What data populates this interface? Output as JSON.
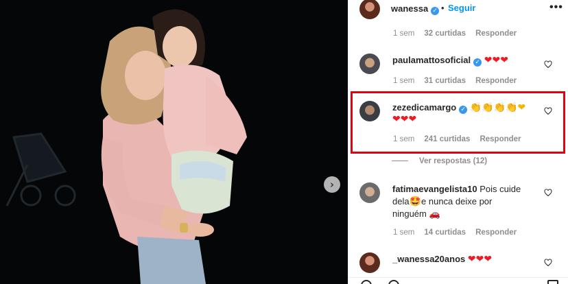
{
  "post": {
    "author": "wanessa",
    "separator": "•",
    "follow_label": "Seguir",
    "more_label": "•••",
    "next_label": "›"
  },
  "comments": [
    {
      "username": "",
      "text": "",
      "time": "1 sem",
      "likes": "32 curtidas",
      "reply_label": "Responder"
    },
    {
      "username": "paulamattosoficial",
      "verified": true,
      "text": "❤❤❤",
      "time": "1 sem",
      "likes": "31 curtidas",
      "reply_label": "Responder"
    },
    {
      "username": "zezedicamargo",
      "verified": true,
      "text_line1": "👏👏👏👏❤",
      "text_line2": "❤❤❤",
      "time": "1 sem",
      "likes": "241 curtidas",
      "reply_label": "Responder",
      "view_replies": "Ver respostas (12)"
    },
    {
      "username": "fatimaevangelista10",
      "text_line1": "Pois cuide",
      "text_line2a": "dela",
      "emoji_face": "🤩",
      "text_line2b": "e nunca deixe por",
      "text_line3": "ninguém",
      "emoji_car": "🚗",
      "time": "1 sem",
      "likes": "14 curtidas",
      "reply_label": "Responder"
    },
    {
      "username": "_wanessa20anos",
      "text": "❤❤❤"
    }
  ],
  "verified_glyph": "✓",
  "colors": {
    "accent": "#0095f6",
    "highlight": "#e3000f",
    "heart": "#ed1c24"
  },
  "icons": [
    "heart-icon",
    "verified-icon",
    "chevron-right-icon",
    "more-options-icon"
  ]
}
